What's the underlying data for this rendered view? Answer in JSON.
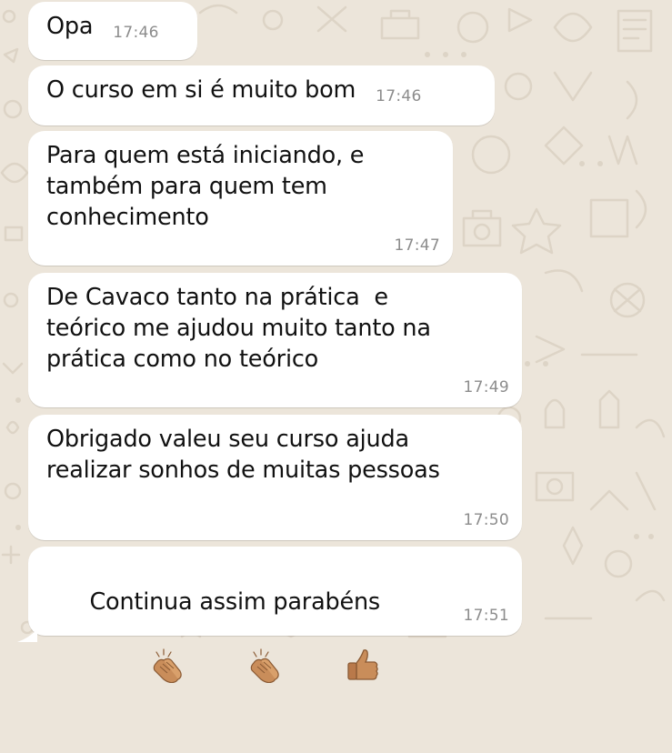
{
  "colors": {
    "wallpaper": "#ece5da",
    "bubble_incoming": "#ffffff",
    "text": "#111111",
    "timestamp": "#8c8c8c",
    "emoji_skin": "#c98d5a"
  },
  "messages": [
    {
      "text": "Opa",
      "time": "17:46"
    },
    {
      "text": "O curso em si é muito bom",
      "time": "17:46"
    },
    {
      "text": "Para quem está iniciando, e\ntambém para quem tem\nconhecimento",
      "time": "17:47"
    },
    {
      "text": "De Cavaco tanto na prática  e\nteórico me ajudou muito tanto na\nprática como no teórico",
      "time": "17:49"
    },
    {
      "text": "Obrigado valeu seu curso ajuda\nrealizar sonhos de muitas pessoas",
      "time": "17:50"
    },
    {
      "text": "Continua assim parabéns",
      "time": "17:51",
      "emojis": [
        "clapping-hands-icon",
        "clapping-hands-icon",
        "thumbs-up-icon"
      ]
    }
  ]
}
